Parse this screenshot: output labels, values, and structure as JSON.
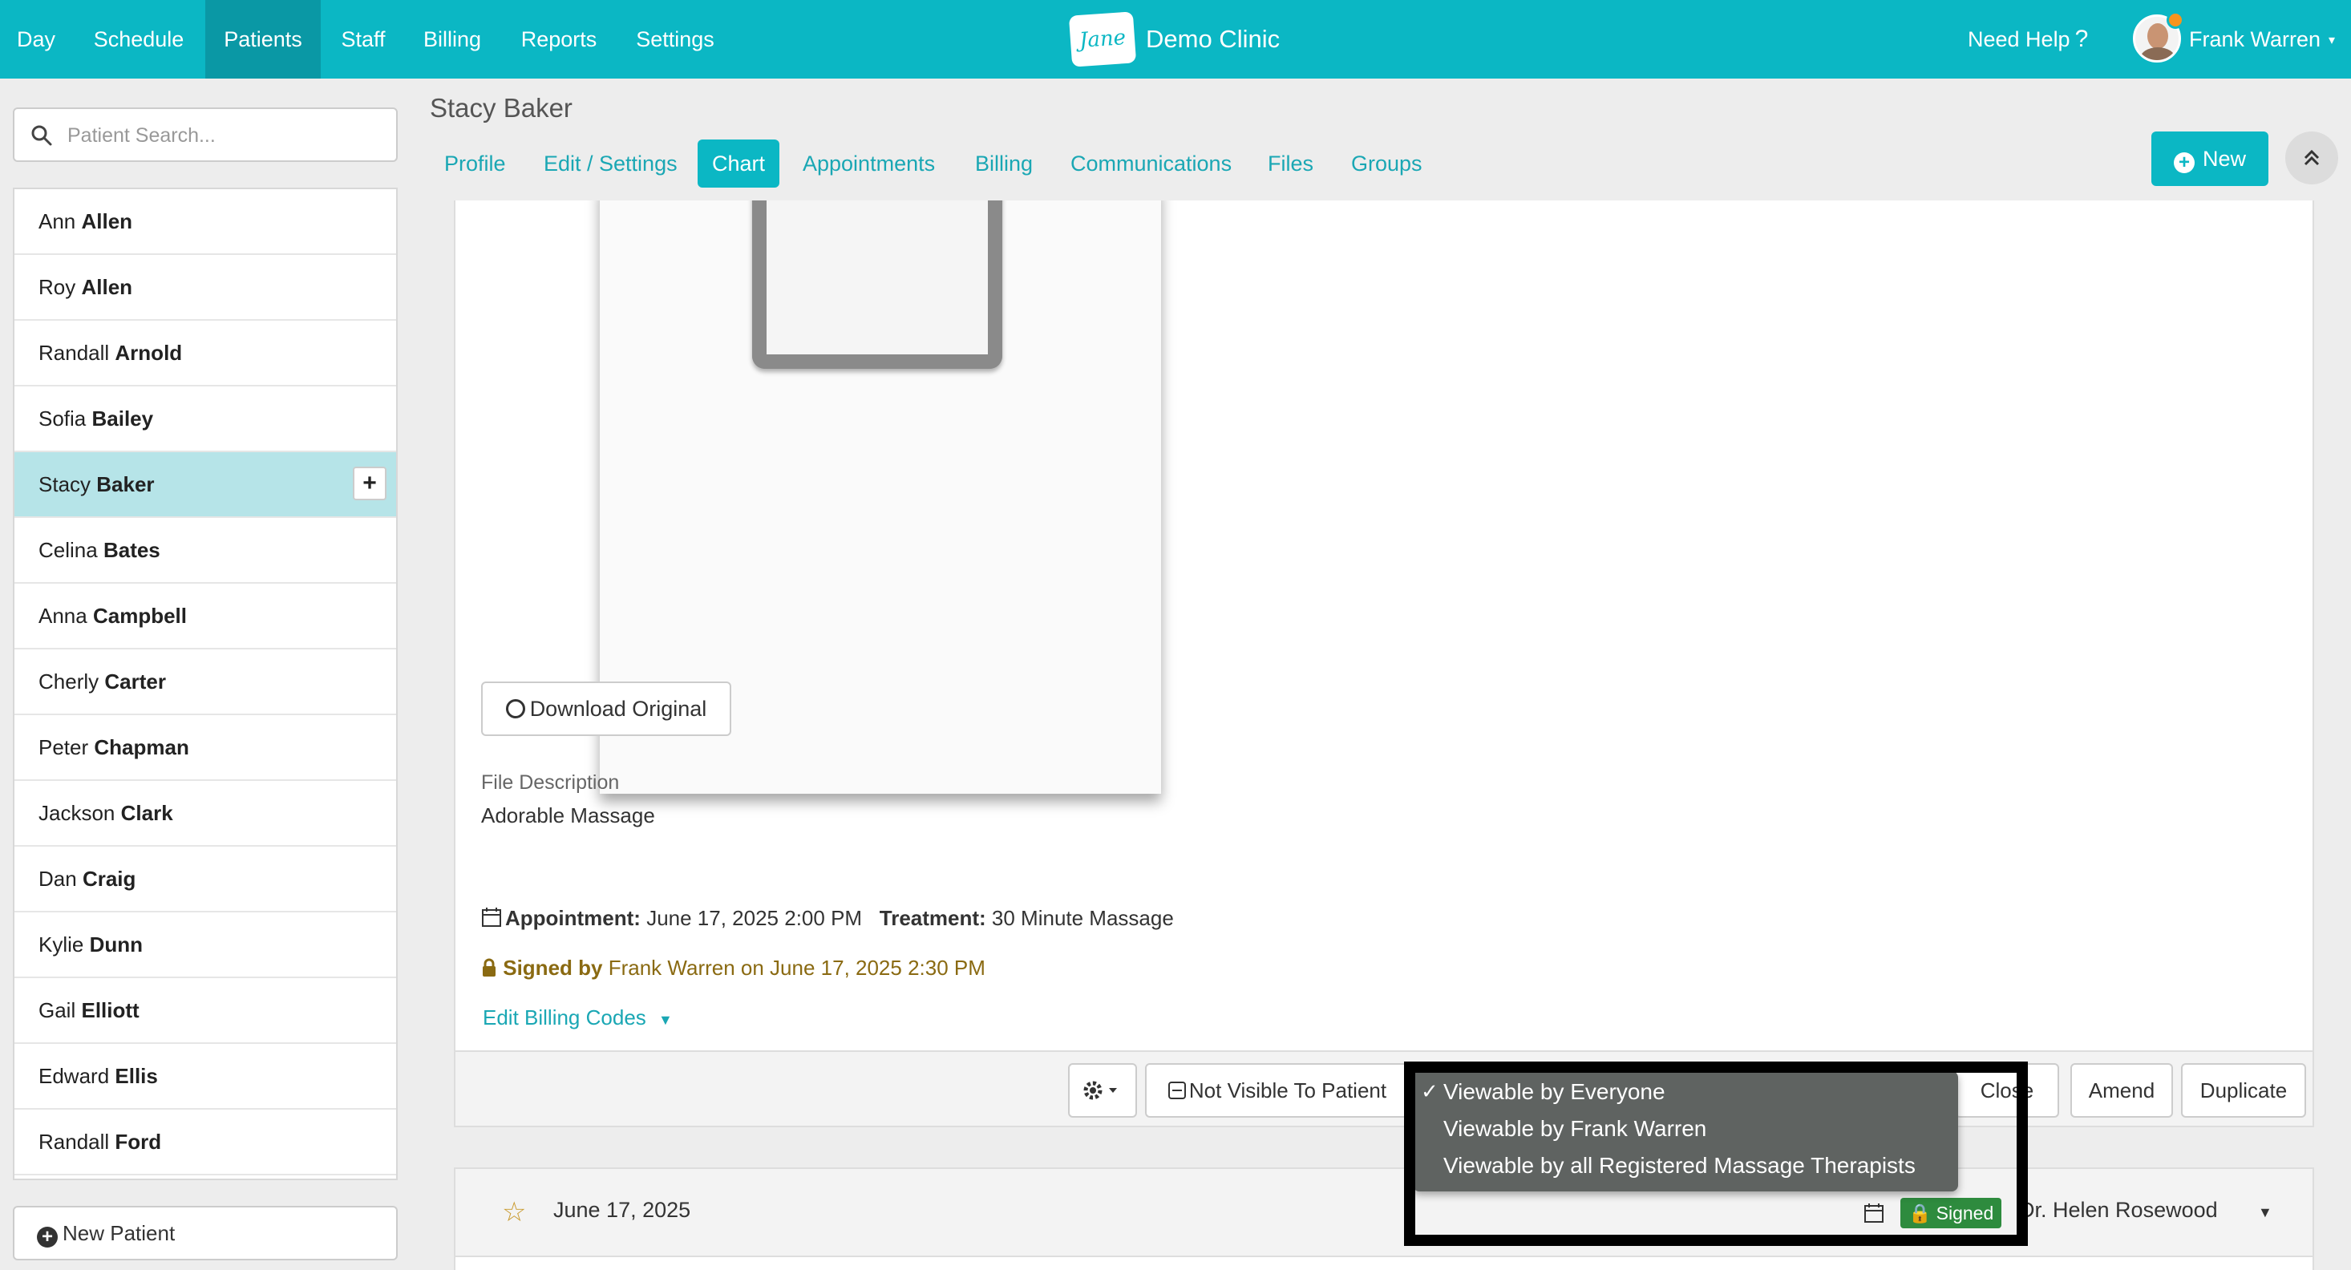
{
  "nav": {
    "items": [
      "Day",
      "Schedule",
      "Patients",
      "Staff",
      "Billing",
      "Reports",
      "Settings"
    ],
    "active": "Patients",
    "logo_text": "Jane",
    "clinic_name": "Demo Clinic",
    "help_label": "Need Help",
    "help_mark": "?",
    "user_name": "Frank Warren",
    "caret": "▾"
  },
  "sidebar": {
    "search_placeholder": "Patient Search...",
    "patients": [
      {
        "first": "Ann",
        "last": "Allen"
      },
      {
        "first": "Roy",
        "last": "Allen"
      },
      {
        "first": "Randall",
        "last": "Arnold"
      },
      {
        "first": "Sofia",
        "last": "Bailey"
      },
      {
        "first": "Stacy",
        "last": "Baker",
        "active": true
      },
      {
        "first": "Celina",
        "last": "Bates"
      },
      {
        "first": "Anna",
        "last": "Campbell"
      },
      {
        "first": "Cherly",
        "last": "Carter"
      },
      {
        "first": "Peter",
        "last": "Chapman"
      },
      {
        "first": "Jackson",
        "last": "Clark"
      },
      {
        "first": "Dan",
        "last": "Craig"
      },
      {
        "first": "Kylie",
        "last": "Dunn"
      },
      {
        "first": "Gail",
        "last": "Elliott"
      },
      {
        "first": "Edward",
        "last": "Ellis"
      },
      {
        "first": "Randall",
        "last": "Ford"
      }
    ],
    "add_symbol": "+",
    "new_patient_label": "New Patient"
  },
  "patient": {
    "name": "Stacy Baker",
    "tabs": [
      "Profile",
      "Edit / Settings",
      "Chart",
      "Appointments",
      "Billing",
      "Communications",
      "Files",
      "Groups"
    ],
    "active_tab": "Chart",
    "new_button": "New"
  },
  "chart_entry": {
    "download_label": "Download Original",
    "file_description_label": "File Description",
    "file_description": "Adorable Massage",
    "appointment_label": "Appointment:",
    "appointment_value": "June 17, 2025 2:00 PM",
    "treatment_label": "Treatment:",
    "treatment_value": "30 Minute Massage",
    "signed_by_label": "Signed by",
    "signed_by_value": "Frank Warren on June 17, 2025 2:30 PM",
    "edit_billing_codes": "Edit Billing Codes",
    "footer": {
      "visibility_label": "Not Visible To Patient",
      "close_label": "Close",
      "amend_label": "Amend",
      "duplicate_label": "Duplicate"
    }
  },
  "visibility_menu": {
    "check_mark": "✓",
    "options": [
      "Viewable by Everyone",
      "Viewable by Frank Warren",
      "Viewable by all Registered Massage Therapists"
    ],
    "selected": "Viewable by Everyone"
  },
  "next_entry": {
    "date": "June 17, 2025",
    "status": "Signed",
    "practitioner": "Dr. Helen Rosewood"
  },
  "colors": {
    "brand": "#0bb7c4",
    "brand_dark": "#0a98a5",
    "signed_text": "#8a6a12",
    "signed_badge": "#2e8b3e",
    "highlight_border": "#000000"
  }
}
